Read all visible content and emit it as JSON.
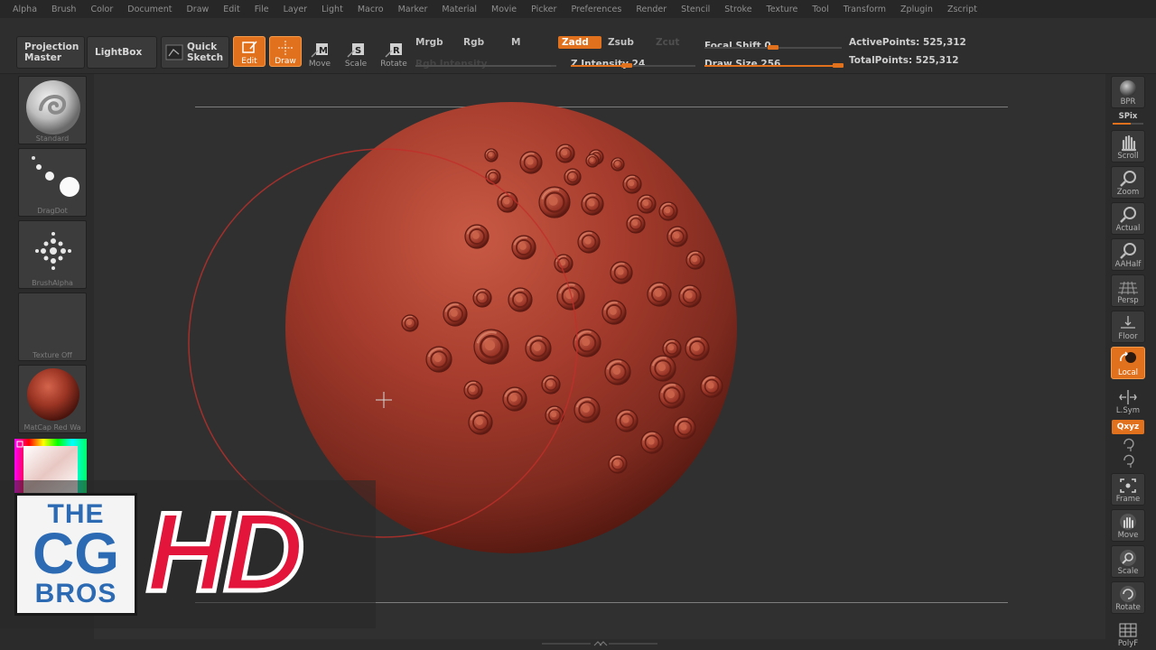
{
  "menu": [
    "Alpha",
    "Brush",
    "Color",
    "Document",
    "Draw",
    "Edit",
    "File",
    "Layer",
    "Light",
    "Macro",
    "Marker",
    "Material",
    "Movie",
    "Picker",
    "Preferences",
    "Render",
    "Stencil",
    "Stroke",
    "Texture",
    "Tool",
    "Transform",
    "Zplugin",
    "Zscript"
  ],
  "shelf": {
    "projection_master": "Projection Master",
    "lightbox": "LightBox",
    "quick_sketch": "Quick Sketch",
    "tools": {
      "edit": "Edit",
      "draw": "Draw",
      "move": "Move",
      "scale": "Scale",
      "rotate": "Rotate"
    },
    "mrgb": "Mrgb",
    "rgb": "Rgb",
    "m": "M",
    "zadd": "Zadd",
    "zsub": "Zsub",
    "zcut": "Zcut",
    "rgb_intensity": "Rgb Intensity",
    "z_intensity": "Z Intensity 24",
    "z_intensity_value": 24,
    "focal_shift": "Focal Shift 0",
    "focal_shift_value": 0,
    "draw_size": "Draw Size 256",
    "draw_size_value": 256,
    "active_points": "ActivePoints: 525,312",
    "total_points": "TotalPoints: 525,312"
  },
  "left_tray": {
    "brush": "Standard",
    "stroke": "DragDot",
    "alpha": "BrushAlpha",
    "texture": "Texture Off",
    "material": "MatCap Red Wa"
  },
  "right_tray": {
    "bpr": "BPR",
    "spix": "SPix",
    "scroll": "Scroll",
    "zoom": "Zoom",
    "actual": "Actual",
    "aahalf": "AAHalf",
    "persp": "Persp",
    "floor": "Floor",
    "local": "Local",
    "lsym": "L.Sym",
    "qxyz": "Qxyz",
    "frame": "Frame",
    "move": "Move",
    "scale": "Scale",
    "rotate": "Rotate",
    "polyf": "PolyF"
  },
  "overlay": {
    "logo_line1": "THE",
    "logo_line2": "CG",
    "logo_line3": "BROS",
    "hd": "HD"
  },
  "colors": {
    "accent": "#e2711d",
    "sculpt": "#a8382a",
    "brush_ring": "#c0302a"
  }
}
